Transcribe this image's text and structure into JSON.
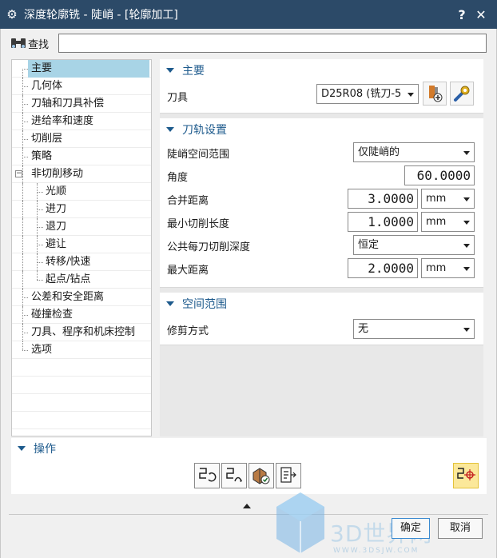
{
  "window": {
    "title": "深度轮廓铣 - 陡峭 - [轮廓加工]",
    "help_label": "?",
    "close_label": "✕"
  },
  "search": {
    "label": "查找",
    "value": ""
  },
  "tree": {
    "items": [
      {
        "label": "主要",
        "level": 0,
        "selected": true
      },
      {
        "label": "几何体",
        "level": 0
      },
      {
        "label": "刀轴和刀具补偿",
        "level": 0
      },
      {
        "label": "进给率和速度",
        "level": 0
      },
      {
        "label": "切削层",
        "level": 0
      },
      {
        "label": "策略",
        "level": 0
      },
      {
        "label": "非切削移动",
        "level": 0,
        "expanded": true
      },
      {
        "label": "光顺",
        "level": 1
      },
      {
        "label": "进刀",
        "level": 1
      },
      {
        "label": "退刀",
        "level": 1
      },
      {
        "label": "避让",
        "level": 1
      },
      {
        "label": "转移/快速",
        "level": 1
      },
      {
        "label": "起点/钻点",
        "level": 1
      },
      {
        "label": "公差和安全距离",
        "level": 0
      },
      {
        "label": "碰撞检查",
        "level": 0
      },
      {
        "label": "刀具、程序和机床控制",
        "level": 0
      },
      {
        "label": "选项",
        "level": 0
      }
    ]
  },
  "main_section": {
    "title": "主要",
    "tool_label": "刀具",
    "tool_value": "D25R08 (铣刀-5"
  },
  "toolpath_section": {
    "title": "刀轨设置",
    "steep_range_label": "陡峭空间范围",
    "steep_range_value": "仅陡峭的",
    "angle_label": "角度",
    "angle_value": "60.0000",
    "merge_label": "合并距离",
    "merge_value": "3.0000",
    "merge_unit": "mm",
    "min_cut_label": "最小切削长度",
    "min_cut_value": "1.0000",
    "min_cut_unit": "mm",
    "depth_label": "公共每刀切削深度",
    "depth_value": "恒定",
    "max_dist_label": "最大距离",
    "max_dist_value": "2.0000",
    "max_dist_unit": "mm"
  },
  "space_section": {
    "title": "空间范围",
    "trim_label": "修剪方式",
    "trim_value": "无"
  },
  "operations": {
    "title": "操作"
  },
  "buttons": {
    "ok": "确定",
    "cancel": "取消"
  },
  "watermark": {
    "text": "3D世界网",
    "sub": "WWW.3DSJW.COM"
  },
  "colors": {
    "titlebar": "#2c4a68",
    "accent": "#1d5a8c",
    "selection": "#a8d4e6",
    "highlight": "#fbe89a"
  }
}
